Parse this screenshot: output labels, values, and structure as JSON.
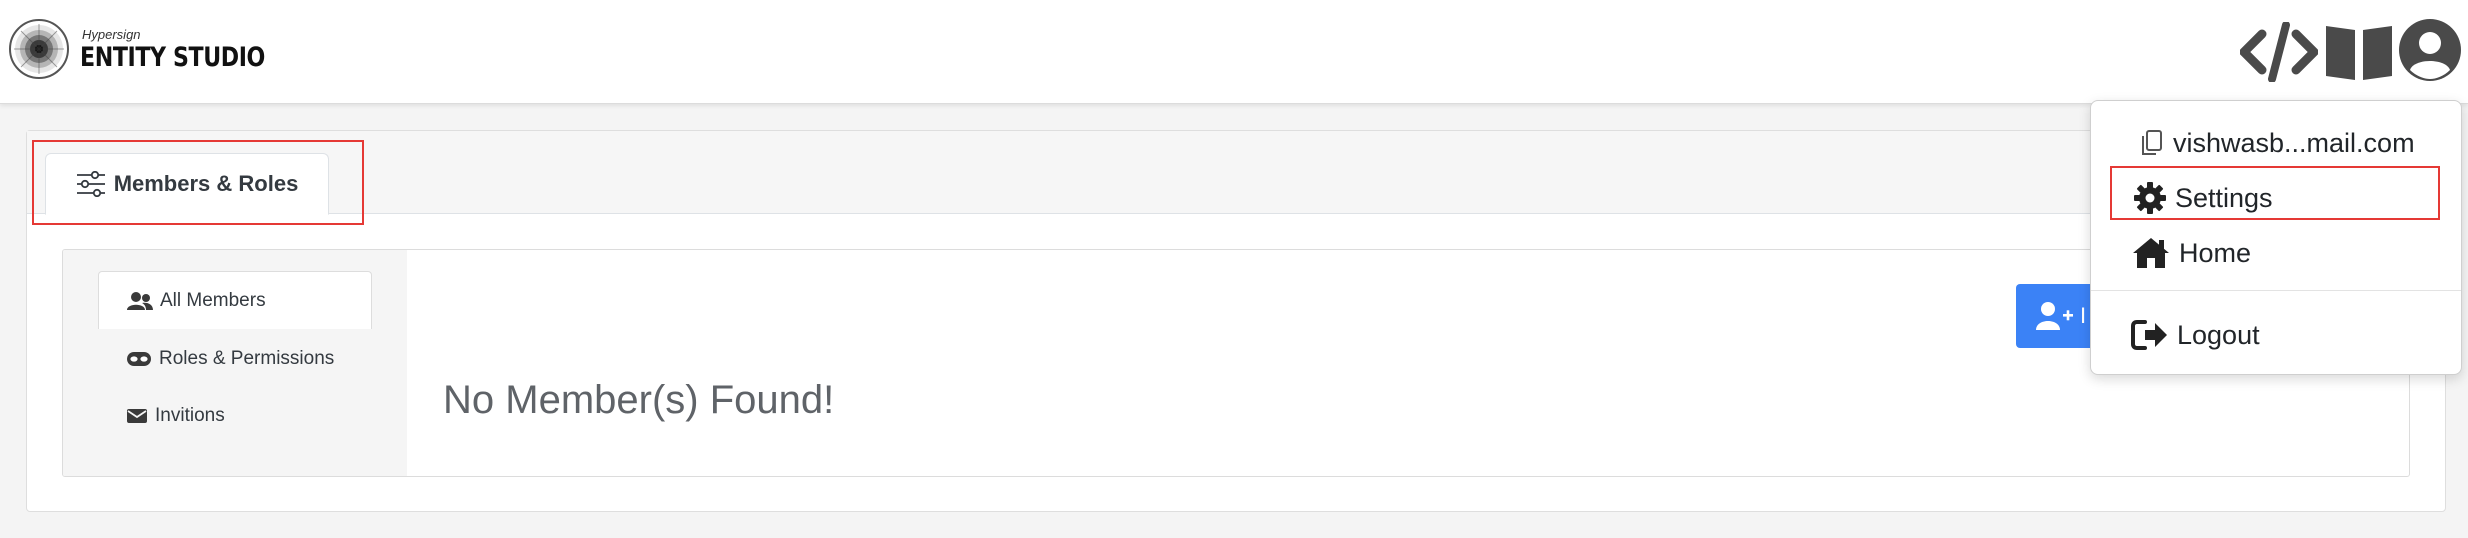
{
  "brand": {
    "subtitle": "Hypersign",
    "title": "ENTITY STUDIO"
  },
  "navbar": {
    "icons": [
      "code-icon",
      "book-icon",
      "user-circle-icon"
    ]
  },
  "tabs": [
    {
      "label": "Members & Roles",
      "icon": "sliders-icon",
      "active": true
    }
  ],
  "sidebar": {
    "items": [
      {
        "label": "All Members",
        "icon": "users-icon",
        "active": true
      },
      {
        "label": "Roles & Permissions",
        "icon": "mask-icon",
        "active": false
      },
      {
        "label": "Invitions",
        "icon": "envelope-icon",
        "active": false
      }
    ]
  },
  "main": {
    "empty_message": "No Member(s) Found!",
    "invite_button_label": "I"
  },
  "dropdown": {
    "email": "vishwasb...mail.com",
    "settings": "Settings",
    "home": "Home",
    "logout": "Logout"
  },
  "colors": {
    "primary": "#3b82f6",
    "highlight": "#e53935",
    "text_muted": "#5f6368"
  }
}
